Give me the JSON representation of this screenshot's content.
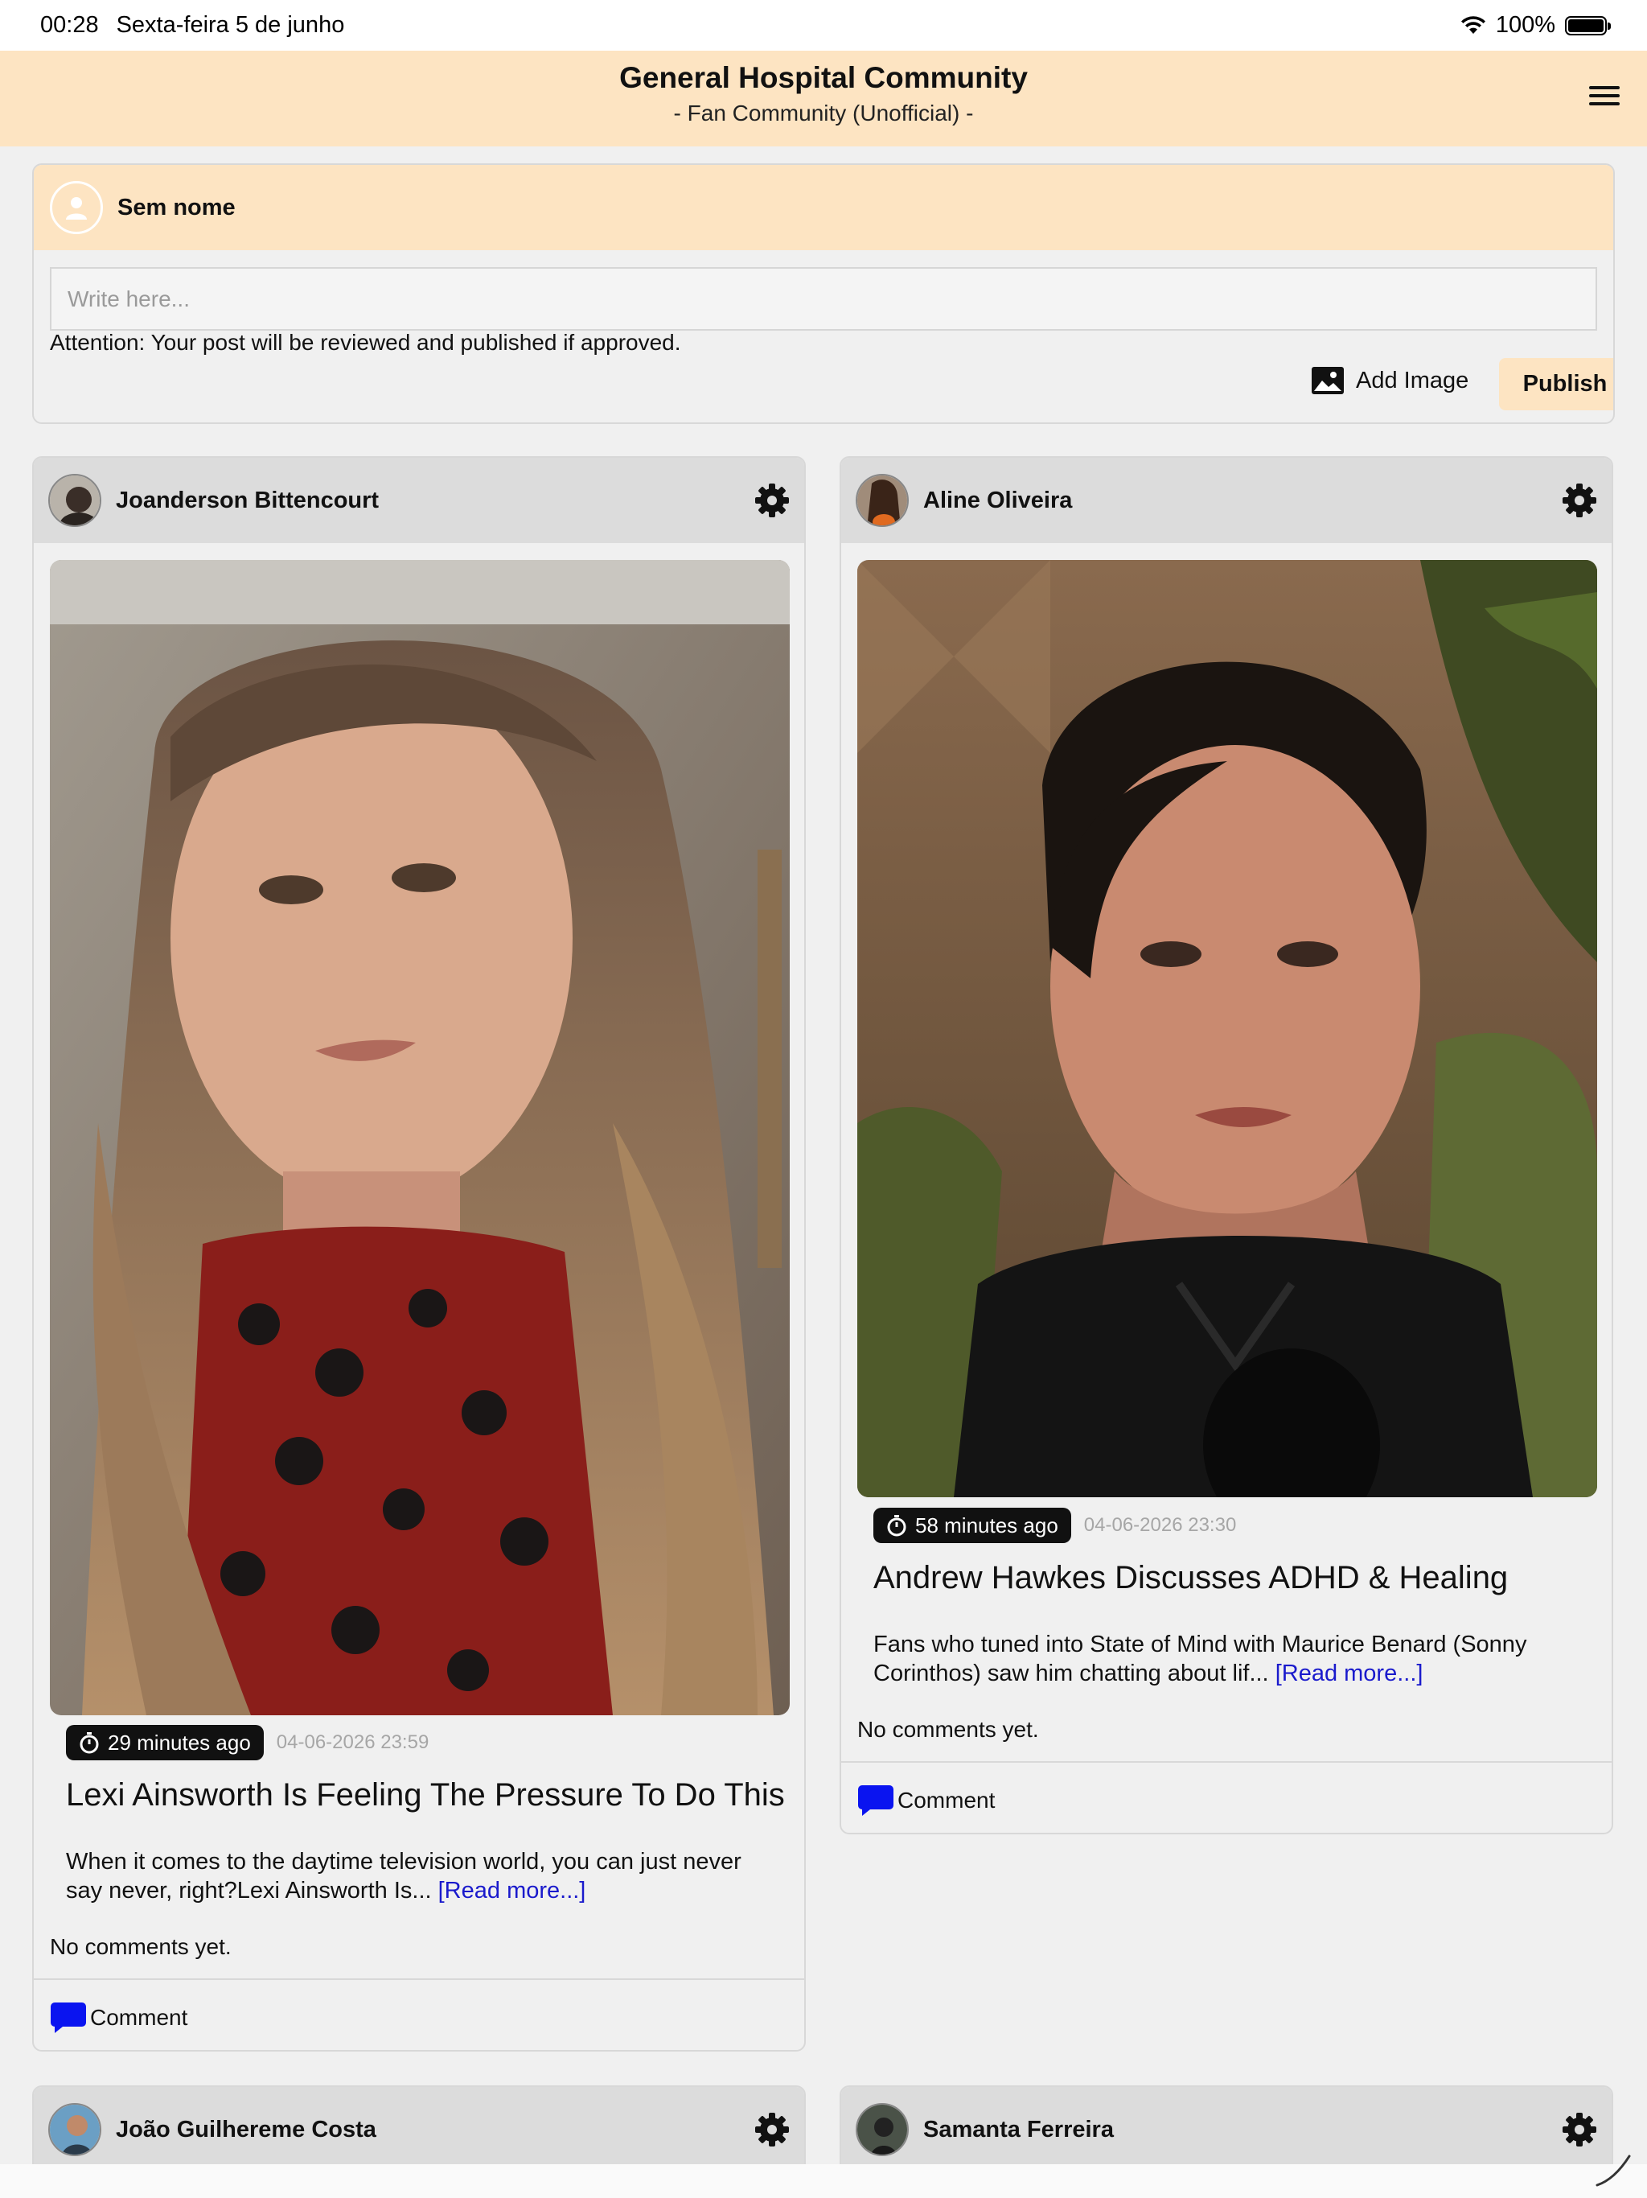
{
  "status_bar": {
    "time": "00:28",
    "date": "Sexta-feira 5 de junho",
    "battery": "100%"
  },
  "header": {
    "title": "General Hospital Community",
    "subtitle": "- Fan Community (Unofficial) -"
  },
  "compose": {
    "user_name": "Sem nome",
    "placeholder": "Write here...",
    "note": "Attention: Your post will be reviewed and published if approved.",
    "add_image_label": "Add Image",
    "publish_label": "Publish"
  },
  "posts": [
    {
      "author": "Joanderson Bittencourt",
      "time_ago": "29 minutes ago",
      "date": "04-06-2026 23:59",
      "title": "Lexi Ainsworth Is Feeling The Pressure To Do This",
      "excerpt": "When it comes to the daytime television world, you can just never say never, right?Lexi Ainsworth Is...",
      "read_more": "[Read more...]",
      "comments_status": "No comments yet.",
      "comment_label": "Comment"
    },
    {
      "author": "Aline Oliveira",
      "time_ago": "58 minutes ago",
      "date": "04-06-2026 23:30",
      "title": "Andrew Hawkes Discusses ADHD & Healing",
      "excerpt": "Fans who tuned into State of Mind with Maurice Benard (Sonny Corinthos) saw him chatting about lif...",
      "read_more": "[Read more...]",
      "comments_status": "No comments yet.",
      "comment_label": "Comment"
    },
    {
      "author": "João Guilhereme Costa"
    },
    {
      "author": "Samanta Ferreira"
    }
  ]
}
